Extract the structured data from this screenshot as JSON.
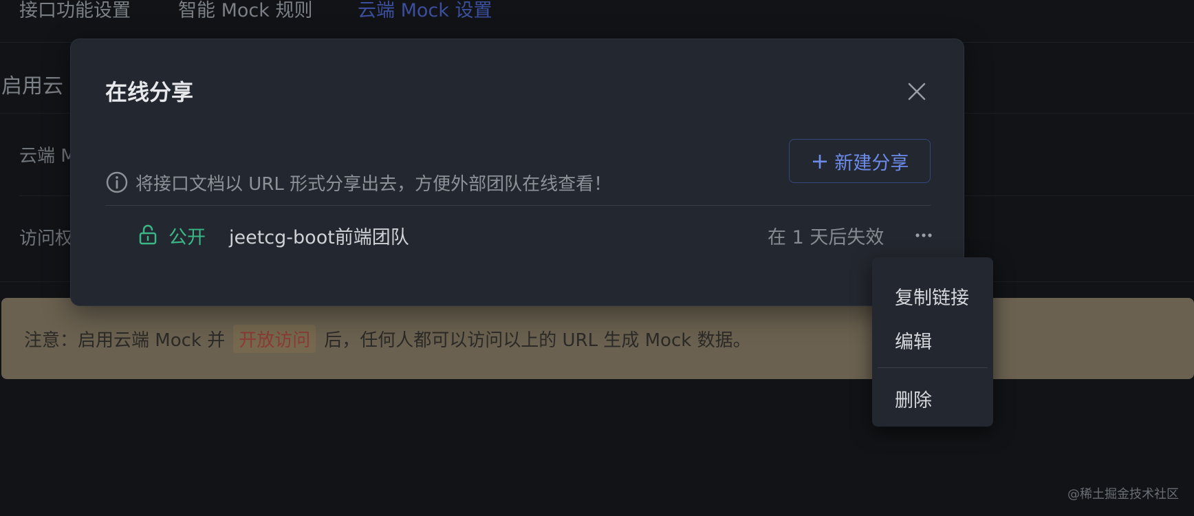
{
  "tabs": [
    {
      "label": "接口功能设置"
    },
    {
      "label": "智能 Mock 规则"
    },
    {
      "label": "云端 Mock 设置"
    }
  ],
  "background": {
    "heading": "启用云",
    "row1_label": "云端 M",
    "row2_label": "访问权"
  },
  "notice": {
    "prefix": "注意：启用云端 Mock 并",
    "highlight": "开放访问",
    "suffix": "后，任何人都可以访问以上的 URL 生成 Mock 数据。"
  },
  "modal": {
    "title": "在线分享",
    "info_text": "将接口文档以 URL 形式分享出去，方便外部团队在线查看！",
    "new_share_label": "新建分享",
    "share": {
      "status": "公开",
      "name": "jeetcg-boot前端团队",
      "expire": "在 1 天后失效"
    }
  },
  "menu": {
    "items": [
      {
        "label": "复制链接"
      },
      {
        "label": "编辑"
      },
      {
        "label": "删除"
      }
    ]
  },
  "watermark": "@稀土掘金技术社区",
  "colors": {
    "accent": "#6d8bea",
    "status_public": "#3bb686",
    "highlight_text": "#8a3b34"
  }
}
